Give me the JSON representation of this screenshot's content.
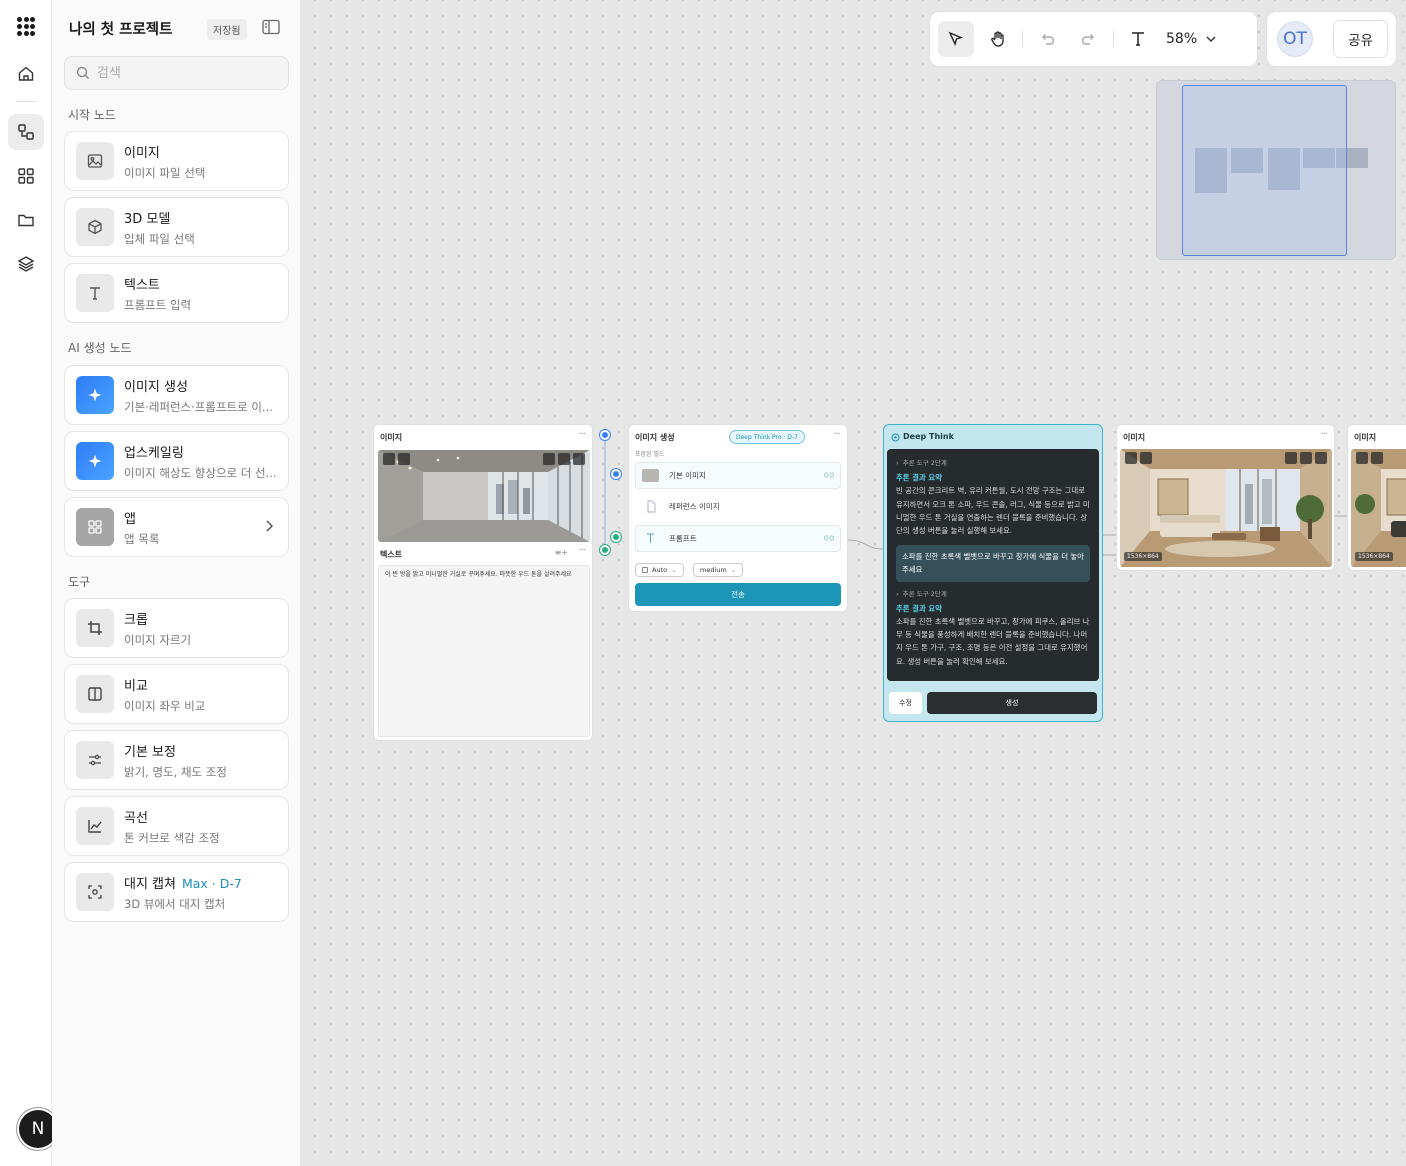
{
  "rail": {
    "user_initial": "N"
  },
  "panel": {
    "title": "나의 첫 프로젝트",
    "saved_badge": "저장됨",
    "search_placeholder": "검색",
    "sections": {
      "start": "시작 노드",
      "ai": "AI 생성 노드",
      "tools": "도구"
    },
    "start_nodes": [
      {
        "title": "이미지",
        "desc": "이미지 파일 선택",
        "icon": "image-icon"
      },
      {
        "title": "3D 모델",
        "desc": "입체 파일 선택",
        "icon": "cube-icon"
      },
      {
        "title": "텍스트",
        "desc": "프롬프트 입력",
        "icon": "text-icon"
      }
    ],
    "ai_nodes": [
      {
        "title": "이미지 생성",
        "desc": "기본·레퍼런스·프롬프트로 이...",
        "icon": "sparkle-icon"
      },
      {
        "title": "업스케일링",
        "desc": "이미지 해상도 향상으로 더 선...",
        "icon": "sparkle-icon"
      },
      {
        "title": "앱",
        "desc": "앱 목록",
        "icon": "grid-icon"
      }
    ],
    "tools": [
      {
        "title": "크롭",
        "desc": "이미지 자르기",
        "icon": "crop-icon"
      },
      {
        "title": "비교",
        "desc": "이미지 좌우 비교",
        "icon": "compare-icon"
      },
      {
        "title": "기본 보정",
        "desc": "밝기, 명도, 채도 조정",
        "icon": "sliders-icon"
      },
      {
        "title": "곡선",
        "desc": "톤 커브로 색감 조정",
        "icon": "curve-icon"
      },
      {
        "title": "대지 캡쳐",
        "badge": "Max · D-7",
        "desc": "3D 뷰에서 대지 캡처",
        "icon": "capture-icon"
      }
    ]
  },
  "toolbar": {
    "zoom": "58%"
  },
  "share": {
    "avatar": "OT",
    "label": "공유"
  },
  "nodes": {
    "image1": {
      "title": "이미지"
    },
    "text1": {
      "title": "텍스트",
      "content": "이 빈 방을 밝고 미니멀한 거실로 꾸며주세요. 따뜻한 우드 톤을 살려주세요"
    },
    "gen": {
      "title": "이미지 생성",
      "badge": "Deep Think Pro · D-7",
      "subtitle": "포함된 필드",
      "fields": [
        "기본 이미지",
        "레퍼런스 이미지",
        "프롬프트"
      ],
      "aspect": "Auto",
      "quality": "medium",
      "send": "전송"
    },
    "deepthink": {
      "title": "Deep Think",
      "step1": "추론 도구 2단계",
      "label1": "추론 결과 요약",
      "text1": "빈 공간의 콘크리트 벽, 유리 커튼월, 도시 전망 구조는 그대로 유지하면서 오크 톤 소파, 우드 콘솔, 러그, 식물 등으로 밝고 미니멀한 우드 톤 거실을 연출하는 렌더 블록을 준비했습니다. 상단의 생성 버튼을 눌러 실행해 보세요.",
      "question": "소파를 진한 초록색 벨벳으로 바꾸고 창가에 식물을 더 놓아주세요",
      "step2": "추론 도구 2단계",
      "label2": "추론 결과 요약",
      "text2": "소파를 진한 초록색 벨벳으로 바꾸고, 창가에 피쿠스, 올리브 나무 등 식물을 풍성하게 배치한 렌더 블록을 준비했습니다. 나머지 우드 톤 가구, 구조, 조명 등은 이전 설정을 그대로 유지했어요. 생성 버튼을 눌러 확인해 보세요.",
      "edit": "수정",
      "generate": "생성"
    },
    "image2": {
      "title": "이미지",
      "dims": "1536×864"
    },
    "image3": {
      "title": "이미지",
      "dims": "1536×864"
    }
  },
  "colors": {
    "accent": "#1d95b8",
    "port_blue": "#3b82f6",
    "port_green": "#22b07d",
    "deepthink_bg": "#c4e7ef"
  }
}
